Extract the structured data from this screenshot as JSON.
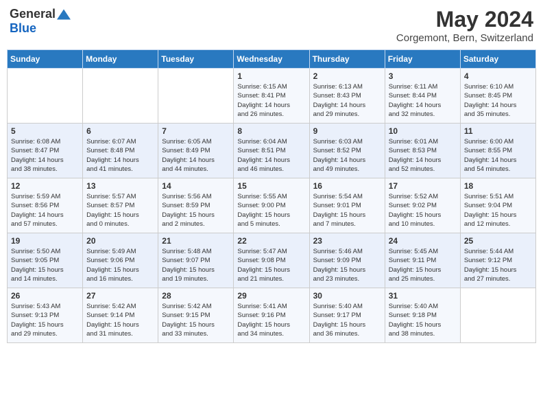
{
  "logo": {
    "general": "General",
    "blue": "Blue"
  },
  "title": {
    "month_year": "May 2024",
    "location": "Corgemont, Bern, Switzerland"
  },
  "weekdays": [
    "Sunday",
    "Monday",
    "Tuesday",
    "Wednesday",
    "Thursday",
    "Friday",
    "Saturday"
  ],
  "weeks": [
    [
      {
        "day": "",
        "info": ""
      },
      {
        "day": "",
        "info": ""
      },
      {
        "day": "",
        "info": ""
      },
      {
        "day": "1",
        "info": "Sunrise: 6:15 AM\nSunset: 8:41 PM\nDaylight: 14 hours\nand 26 minutes."
      },
      {
        "day": "2",
        "info": "Sunrise: 6:13 AM\nSunset: 8:43 PM\nDaylight: 14 hours\nand 29 minutes."
      },
      {
        "day": "3",
        "info": "Sunrise: 6:11 AM\nSunset: 8:44 PM\nDaylight: 14 hours\nand 32 minutes."
      },
      {
        "day": "4",
        "info": "Sunrise: 6:10 AM\nSunset: 8:45 PM\nDaylight: 14 hours\nand 35 minutes."
      }
    ],
    [
      {
        "day": "5",
        "info": "Sunrise: 6:08 AM\nSunset: 8:47 PM\nDaylight: 14 hours\nand 38 minutes."
      },
      {
        "day": "6",
        "info": "Sunrise: 6:07 AM\nSunset: 8:48 PM\nDaylight: 14 hours\nand 41 minutes."
      },
      {
        "day": "7",
        "info": "Sunrise: 6:05 AM\nSunset: 8:49 PM\nDaylight: 14 hours\nand 44 minutes."
      },
      {
        "day": "8",
        "info": "Sunrise: 6:04 AM\nSunset: 8:51 PM\nDaylight: 14 hours\nand 46 minutes."
      },
      {
        "day": "9",
        "info": "Sunrise: 6:03 AM\nSunset: 8:52 PM\nDaylight: 14 hours\nand 49 minutes."
      },
      {
        "day": "10",
        "info": "Sunrise: 6:01 AM\nSunset: 8:53 PM\nDaylight: 14 hours\nand 52 minutes."
      },
      {
        "day": "11",
        "info": "Sunrise: 6:00 AM\nSunset: 8:55 PM\nDaylight: 14 hours\nand 54 minutes."
      }
    ],
    [
      {
        "day": "12",
        "info": "Sunrise: 5:59 AM\nSunset: 8:56 PM\nDaylight: 14 hours\nand 57 minutes."
      },
      {
        "day": "13",
        "info": "Sunrise: 5:57 AM\nSunset: 8:57 PM\nDaylight: 15 hours\nand 0 minutes."
      },
      {
        "day": "14",
        "info": "Sunrise: 5:56 AM\nSunset: 8:59 PM\nDaylight: 15 hours\nand 2 minutes."
      },
      {
        "day": "15",
        "info": "Sunrise: 5:55 AM\nSunset: 9:00 PM\nDaylight: 15 hours\nand 5 minutes."
      },
      {
        "day": "16",
        "info": "Sunrise: 5:54 AM\nSunset: 9:01 PM\nDaylight: 15 hours\nand 7 minutes."
      },
      {
        "day": "17",
        "info": "Sunrise: 5:52 AM\nSunset: 9:02 PM\nDaylight: 15 hours\nand 10 minutes."
      },
      {
        "day": "18",
        "info": "Sunrise: 5:51 AM\nSunset: 9:04 PM\nDaylight: 15 hours\nand 12 minutes."
      }
    ],
    [
      {
        "day": "19",
        "info": "Sunrise: 5:50 AM\nSunset: 9:05 PM\nDaylight: 15 hours\nand 14 minutes."
      },
      {
        "day": "20",
        "info": "Sunrise: 5:49 AM\nSunset: 9:06 PM\nDaylight: 15 hours\nand 16 minutes."
      },
      {
        "day": "21",
        "info": "Sunrise: 5:48 AM\nSunset: 9:07 PM\nDaylight: 15 hours\nand 19 minutes."
      },
      {
        "day": "22",
        "info": "Sunrise: 5:47 AM\nSunset: 9:08 PM\nDaylight: 15 hours\nand 21 minutes."
      },
      {
        "day": "23",
        "info": "Sunrise: 5:46 AM\nSunset: 9:09 PM\nDaylight: 15 hours\nand 23 minutes."
      },
      {
        "day": "24",
        "info": "Sunrise: 5:45 AM\nSunset: 9:11 PM\nDaylight: 15 hours\nand 25 minutes."
      },
      {
        "day": "25",
        "info": "Sunrise: 5:44 AM\nSunset: 9:12 PM\nDaylight: 15 hours\nand 27 minutes."
      }
    ],
    [
      {
        "day": "26",
        "info": "Sunrise: 5:43 AM\nSunset: 9:13 PM\nDaylight: 15 hours\nand 29 minutes."
      },
      {
        "day": "27",
        "info": "Sunrise: 5:42 AM\nSunset: 9:14 PM\nDaylight: 15 hours\nand 31 minutes."
      },
      {
        "day": "28",
        "info": "Sunrise: 5:42 AM\nSunset: 9:15 PM\nDaylight: 15 hours\nand 33 minutes."
      },
      {
        "day": "29",
        "info": "Sunrise: 5:41 AM\nSunset: 9:16 PM\nDaylight: 15 hours\nand 34 minutes."
      },
      {
        "day": "30",
        "info": "Sunrise: 5:40 AM\nSunset: 9:17 PM\nDaylight: 15 hours\nand 36 minutes."
      },
      {
        "day": "31",
        "info": "Sunrise: 5:40 AM\nSunset: 9:18 PM\nDaylight: 15 hours\nand 38 minutes."
      },
      {
        "day": "",
        "info": ""
      }
    ]
  ]
}
